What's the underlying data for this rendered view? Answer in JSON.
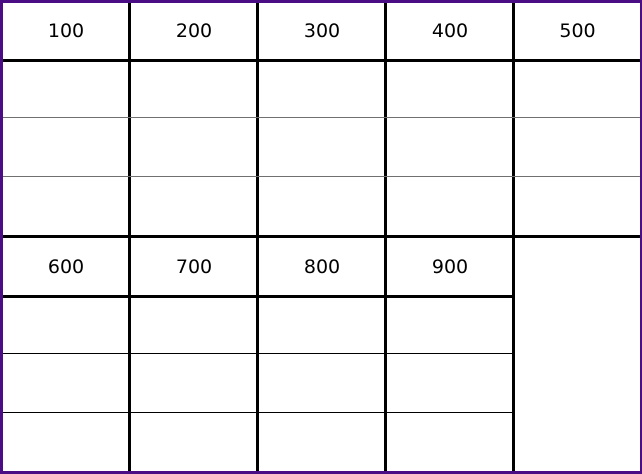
{
  "grid": {
    "top_headers": [
      "100",
      "200",
      "300",
      "400",
      "500"
    ],
    "bottom_headers": [
      "600",
      "700",
      "800",
      "900"
    ],
    "rows_per_block": 3
  },
  "colors": {
    "frame": "#4b0d84",
    "lines": "#000000",
    "background": "#ffffff"
  }
}
